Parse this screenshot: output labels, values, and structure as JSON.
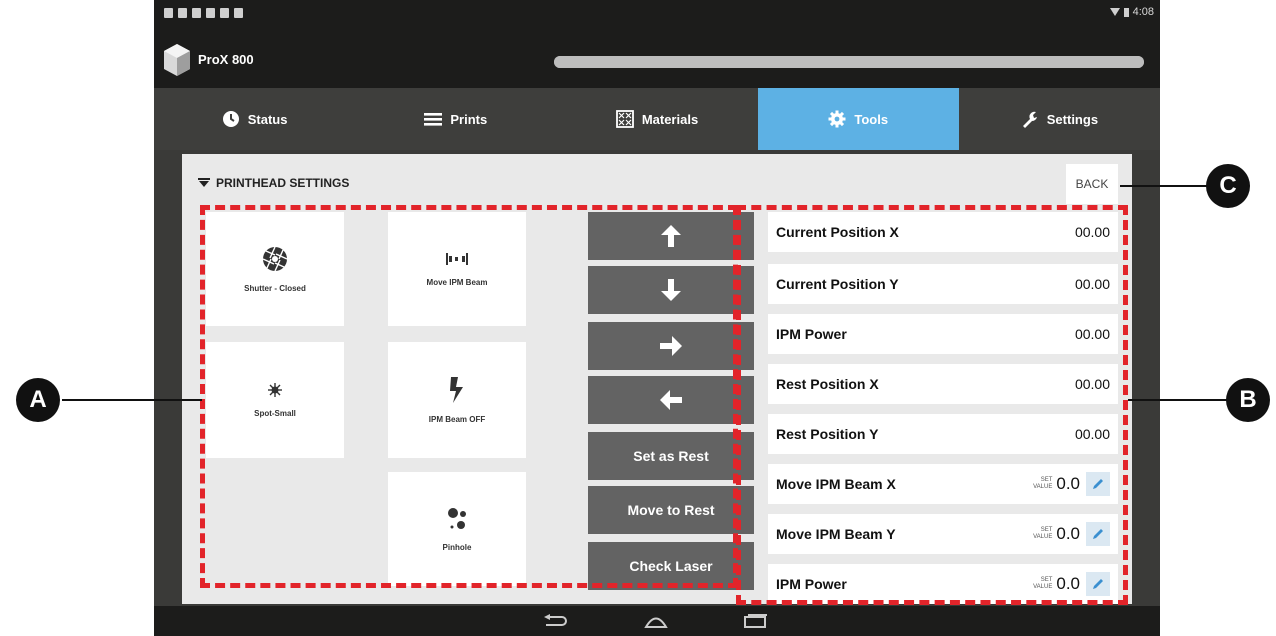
{
  "statusbar": {
    "time": "4:08"
  },
  "app": {
    "title": "ProX 800"
  },
  "tabs": [
    {
      "label": "Status",
      "icon": "clock-icon"
    },
    {
      "label": "Prints",
      "icon": "list-icon"
    },
    {
      "label": "Materials",
      "icon": "materials-icon"
    },
    {
      "label": "Tools",
      "icon": "gear-icon",
      "active": true
    },
    {
      "label": "Settings",
      "icon": "wrench-icon"
    }
  ],
  "panel": {
    "title": "PRINTHEAD SETTINGS",
    "back_label": "BACK"
  },
  "tiles": [
    {
      "label": "Shutter - Closed",
      "icon": "shutter-icon"
    },
    {
      "label": "Move IPM Beam",
      "icon": "move-beam-icon"
    },
    {
      "label": "Spot-Small",
      "icon": "spot-icon"
    },
    {
      "label": "IPM Beam OFF",
      "icon": "lightning-icon"
    },
    {
      "label": "Pinhole",
      "icon": "pinhole-icon"
    }
  ],
  "actions": {
    "up": "up-arrow-icon",
    "down": "down-arrow-icon",
    "right": "right-arrow-icon",
    "left": "left-arrow-icon",
    "set_rest": "Set as Rest",
    "move_rest": "Move to Rest",
    "check_laser": "Check Laser"
  },
  "values": [
    {
      "label": "Current Position X",
      "value": "00.00"
    },
    {
      "label": "Current Position Y",
      "value": "00.00"
    },
    {
      "label": "IPM Power",
      "value": "00.00"
    },
    {
      "label": "Rest Position X",
      "value": "00.00"
    },
    {
      "label": "Rest Position Y",
      "value": "00.00"
    }
  ],
  "editable": [
    {
      "label": "Move IPM Beam X",
      "set_top": "SET",
      "set_bottom": "VALUE",
      "value": "0.0"
    },
    {
      "label": "Move IPM Beam Y",
      "set_top": "SET",
      "set_bottom": "VALUE",
      "value": "0.0"
    },
    {
      "label": "IPM Power",
      "set_top": "SET",
      "set_bottom": "VALUE",
      "value": "0.0"
    }
  ],
  "callouts": {
    "a": "A",
    "b": "B",
    "c": "C"
  },
  "colors": {
    "accent": "#5db1e4",
    "highlight": "#e2242a",
    "button": "#636363"
  }
}
